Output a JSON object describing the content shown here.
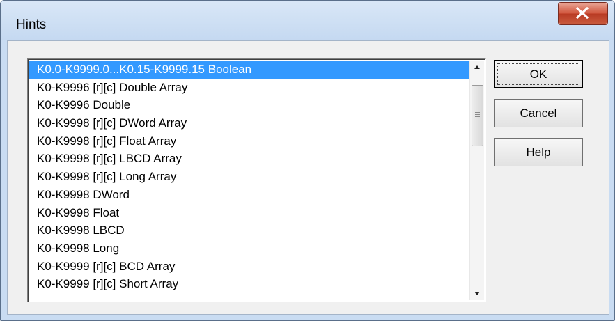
{
  "window": {
    "title": "Hints"
  },
  "list": {
    "items": [
      "K0.0-K9999.0...K0.15-K9999.15 Boolean",
      "K0-K9996 [r][c] Double Array",
      "K0-K9996 Double",
      "K0-K9998 [r][c] DWord Array",
      "K0-K9998 [r][c] Float Array",
      "K0-K9998 [r][c] LBCD Array",
      "K0-K9998 [r][c] Long Array",
      "K0-K9998 DWord",
      "K0-K9998 Float",
      "K0-K9998 LBCD",
      "K0-K9998 Long",
      "K0-K9999 [r][c] BCD Array",
      "K0-K9999 [r][c] Short Array"
    ],
    "selected_index": 0
  },
  "buttons": {
    "ok": "OK",
    "cancel": "Cancel",
    "help_accel": "H",
    "help_rest": "elp"
  },
  "colors": {
    "selection": "#3399ff",
    "close_button": "#c9523a"
  }
}
